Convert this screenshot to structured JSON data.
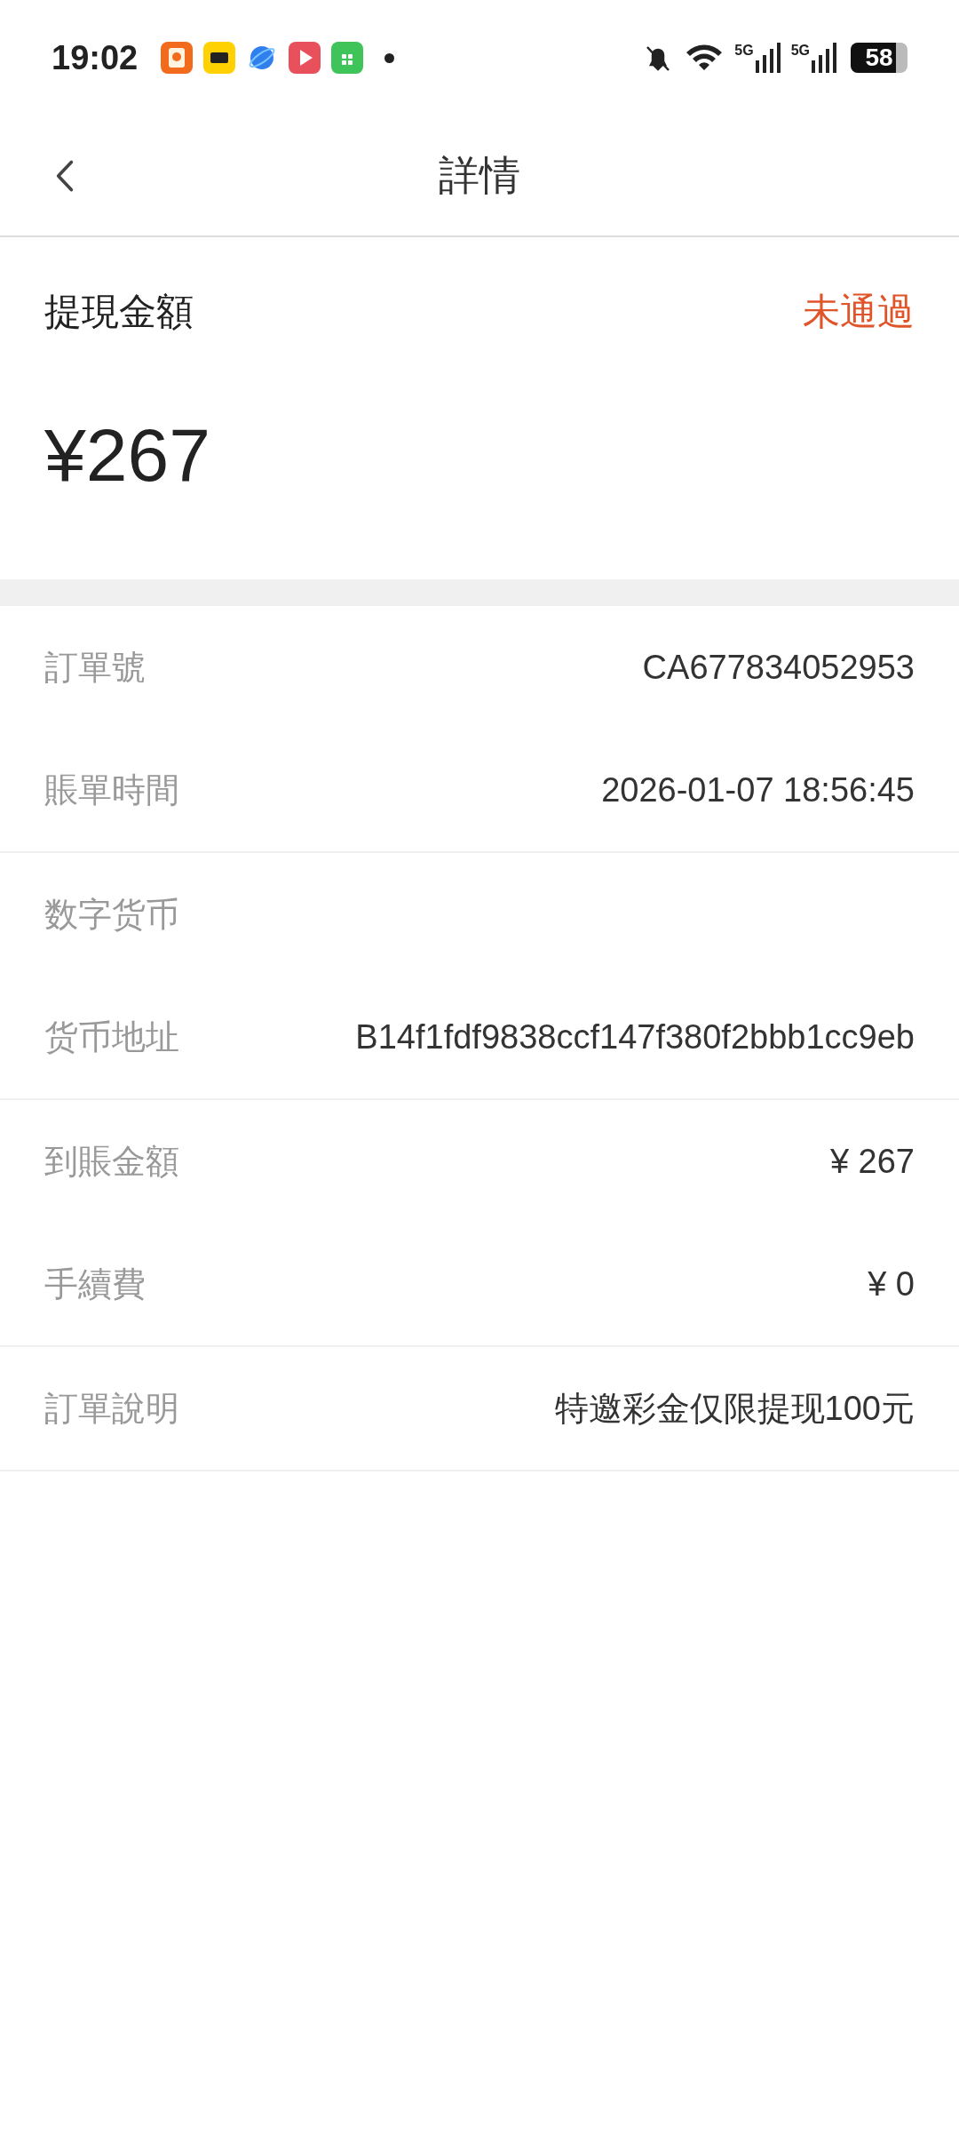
{
  "status_bar": {
    "time": "19:02",
    "battery": "58",
    "networks": [
      "5G",
      "5G"
    ]
  },
  "header": {
    "title": "詳情"
  },
  "summary": {
    "label": "提現金額",
    "status": {
      "text": "未通過",
      "kind": "rejected"
    },
    "amount": "¥267"
  },
  "groups": [
    {
      "rows": [
        {
          "label": "訂單號",
          "value": "CA677834052953"
        },
        {
          "label": "賬單時間",
          "value": "2026-01-07 18:56:45"
        }
      ]
    },
    {
      "rows": [
        {
          "label": "数字货币"
        },
        {
          "label": "货币地址",
          "value": "B14f1fdf9838ccf147f380f2bbb1cc9eb"
        }
      ]
    },
    {
      "rows": [
        {
          "label": "到賬金額",
          "value": "¥ 267"
        },
        {
          "label": "手續費",
          "value": "¥ 0"
        }
      ]
    },
    {
      "rows": [
        {
          "label": "訂單說明",
          "value": "特邀彩金仅限提现100元"
        }
      ]
    }
  ]
}
